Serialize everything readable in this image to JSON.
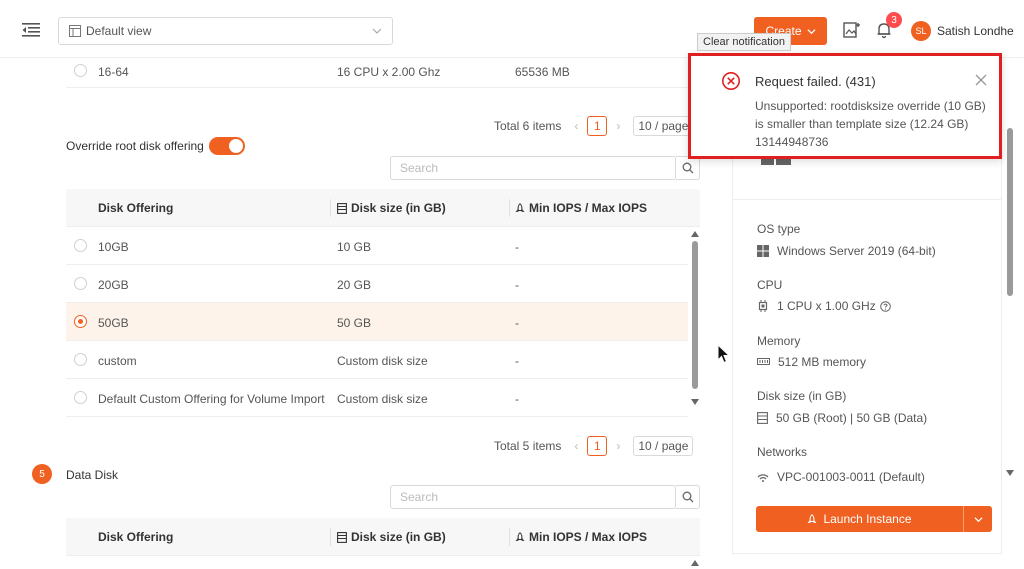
{
  "header": {
    "view_select": "Default view",
    "create_label": "Create",
    "notification_count": "3",
    "avatar_initials": "SL",
    "user_name": "Satish Londhe",
    "clear_tooltip": "Clear notification"
  },
  "compute_offering": {
    "top_row": {
      "name": "16-64",
      "cpu": "16 CPU x 2.00 Ghz",
      "memory": "65536 MB"
    },
    "pagination": {
      "total": "Total 6 items",
      "page": "1",
      "page_size": "10 / page"
    }
  },
  "root_disk": {
    "override_label": "Override root disk offering",
    "override_enabled": true,
    "search_placeholder": "Search",
    "columns": [
      "Disk Offering",
      "Disk size (in GB)",
      "Min IOPS / Max IOPS"
    ],
    "rows": [
      {
        "name": "10GB",
        "size": "10 GB",
        "iops": "-",
        "selected": false
      },
      {
        "name": "20GB",
        "size": "20 GB",
        "iops": "-",
        "selected": false
      },
      {
        "name": "50GB",
        "size": "50 GB",
        "iops": "-",
        "selected": true
      },
      {
        "name": "custom",
        "size": "Custom disk size",
        "iops": "-",
        "selected": false
      },
      {
        "name": "Default Custom Offering for Volume Import",
        "size": "Custom disk size",
        "iops": "-",
        "selected": false
      }
    ],
    "pagination": {
      "total": "Total 5 items",
      "page": "1",
      "page_size": "10 / page"
    }
  },
  "data_disk": {
    "step": "5",
    "title": "Data Disk",
    "search_placeholder": "Search",
    "columns": [
      "Disk Offering",
      "Disk size (in GB)",
      "Min IOPS / Max IOPS"
    ]
  },
  "summary": {
    "os_type_label": "OS type",
    "os_type_value": "Windows Server 2019 (64-bit)",
    "cpu_label": "CPU",
    "cpu_value": "1 CPU x 1.00 GHz",
    "memory_label": "Memory",
    "memory_value": "512 MB memory",
    "disk_label": "Disk size (in GB)",
    "disk_value": "50 GB (Root) | 50 GB (Data)",
    "networks_label": "Networks",
    "networks_value": "VPC-001003-0011 (Default)",
    "launch_label": "Launch Instance"
  },
  "notification": {
    "title": "Request failed. (431)",
    "body": "Unsupported: rootdisksize override (10 GB) is smaller than template size (12.24 GB) 13144948736"
  },
  "colors": {
    "accent": "#f06020",
    "error": "#e02020"
  }
}
